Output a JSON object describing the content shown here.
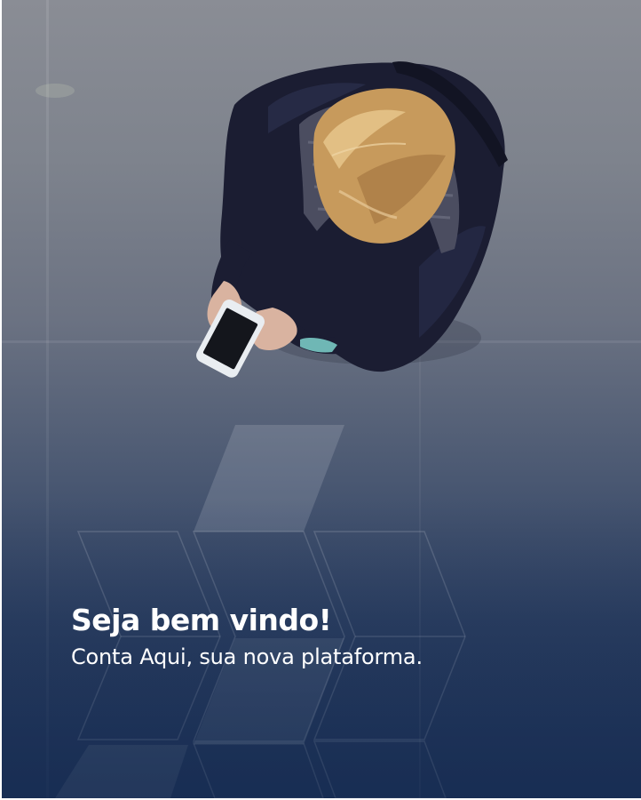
{
  "welcome": {
    "title": "Seja bem vindo!",
    "subtitle": "Conta Aqui, sua nova plataforma."
  },
  "colors": {
    "top": "#8a8d95",
    "bottom": "#1a2f55",
    "text": "#ffffff"
  }
}
